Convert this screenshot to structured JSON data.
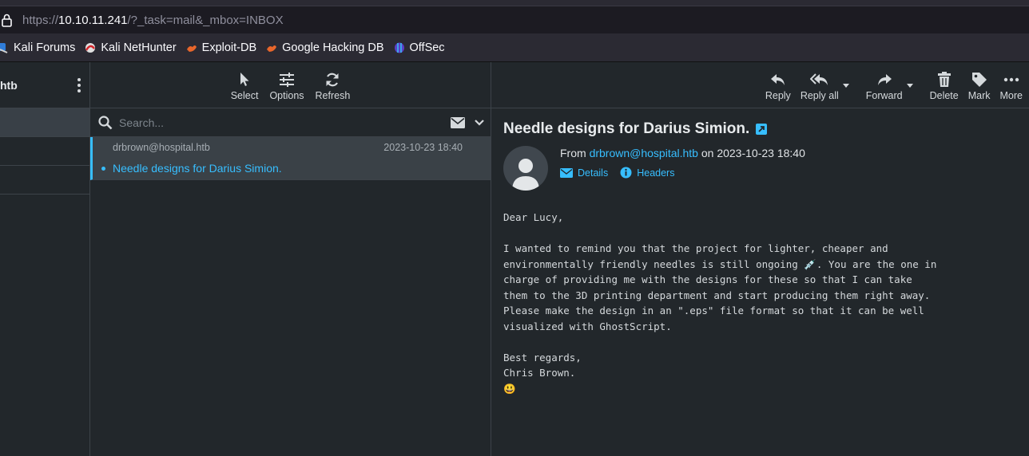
{
  "browser": {
    "url_prefix": "https://",
    "url_host": "10.10.11.241",
    "url_path": "/?_task=mail&_mbox=INBOX"
  },
  "bookmarks": [
    {
      "label": "Kali Forums",
      "icon": "kali-forums-icon"
    },
    {
      "label": "Kali NetHunter",
      "icon": "nethunter-icon"
    },
    {
      "label": "Exploit-DB",
      "icon": "exploitdb-icon"
    },
    {
      "label": "Google Hacking DB",
      "icon": "ghdb-icon"
    },
    {
      "label": "OffSec",
      "icon": "offsec-icon"
    }
  ],
  "sidebar": {
    "account_label": "htb"
  },
  "list_toolbar": {
    "select": "Select",
    "options": "Options",
    "refresh": "Refresh"
  },
  "search": {
    "placeholder": "Search..."
  },
  "messages": [
    {
      "from": "drbrown@hospital.htb",
      "date": "2023-10-23 18:40",
      "subject": "Needle designs for Darius Simion."
    }
  ],
  "view_toolbar": {
    "reply": "Reply",
    "reply_all": "Reply all",
    "forward": "Forward",
    "delete": "Delete",
    "mark": "Mark",
    "more": "More"
  },
  "message": {
    "title": "Needle designs for Darius Simion.",
    "from_prefix": "From ",
    "from_address": "drbrown@hospital.htb",
    "on_text": " on 2023-10-23 18:40",
    "details_label": "Details",
    "headers_label": "Headers",
    "body": "Dear Lucy,\n\nI wanted to remind you that the project for lighter, cheaper and\nenvironmentally friendly needles is still ongoing 💉. You are the one in\ncharge of providing me with the designs for these so that I can take\nthem to the 3D printing department and start producing them right away.\nPlease make the design in an \".eps\" file format so that it can be well\nvisualized with GhostScript.\n\nBest regards,\nChris Brown.\n😃"
  },
  "colors": {
    "accent": "#37beff",
    "background": "#22272b",
    "selected_row": "#3a4147"
  }
}
